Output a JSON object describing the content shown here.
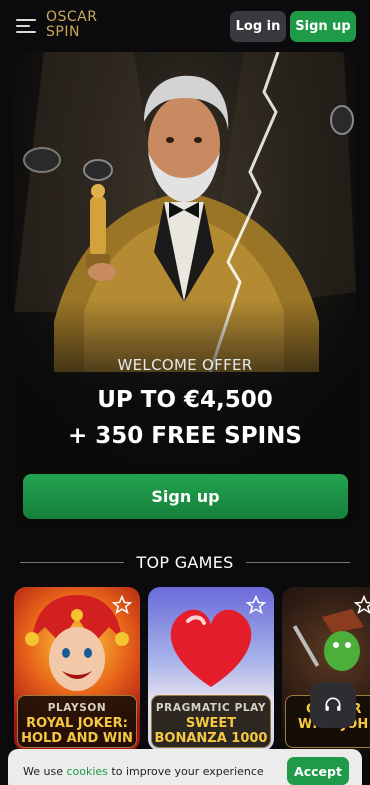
{
  "header": {
    "logo_line1": "OSCAR",
    "logo_line2": "SPIN",
    "login_label": "Log in",
    "signup_label": "Sign up"
  },
  "hero": {
    "eyebrow": "WELCOME OFFER",
    "line1": "UP TO €4,500",
    "line2": "+ 350 FREE SPINS",
    "cta_label": "Sign up"
  },
  "top_games": {
    "title": "TOP GAMES",
    "cards": [
      {
        "provider": "PLAYSON",
        "name_l1": "ROYAL JOKER:",
        "name_l2": "HOLD AND WIN"
      },
      {
        "provider": "PRAGMATIC PLAY",
        "name_l1": "SWEET",
        "name_l2": "BONANZA 1000"
      },
      {
        "provider": "",
        "name_l1": "GOLD R",
        "name_l2": "WITH JOH"
      }
    ]
  },
  "cookie": {
    "text_before": "We use ",
    "link": "cookies",
    "text_after": " to improve your experience",
    "accept_label": "Accept"
  },
  "colors": {
    "brand_gold": "#c9a85a",
    "primary_green": "#1e9a48",
    "background": "#0b0b0d"
  }
}
